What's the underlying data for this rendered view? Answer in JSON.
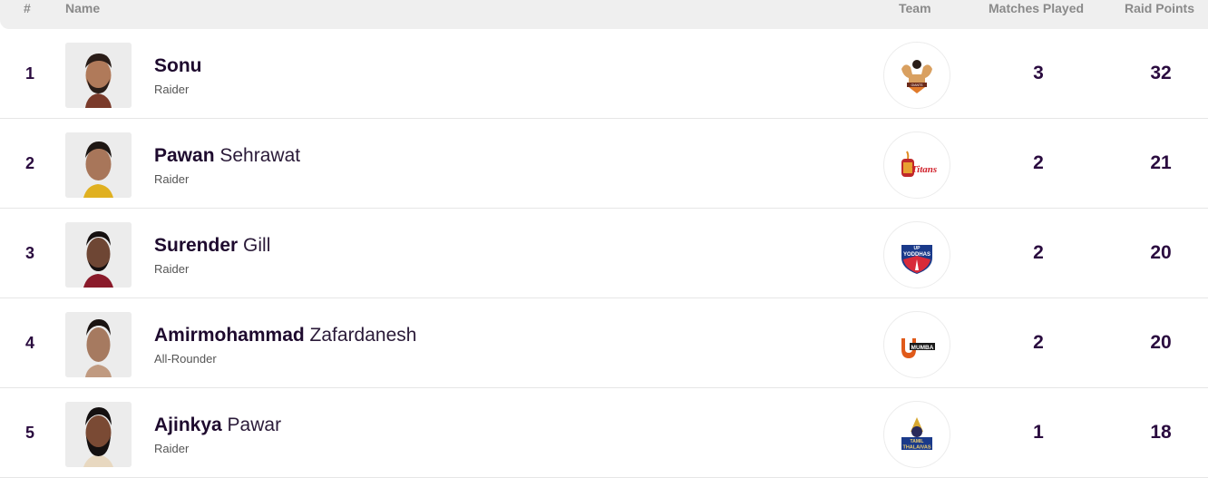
{
  "header": {
    "rank": "#",
    "name": "Name",
    "team": "Team",
    "matches": "Matches Played",
    "raid": "Raid Points"
  },
  "rows": [
    {
      "rank": "1",
      "first": "Sonu",
      "last": "",
      "role": "Raider",
      "team": "Gujarat Giants",
      "team_icon": "gujarat-giants-logo-icon",
      "matches": "3",
      "raid": "32"
    },
    {
      "rank": "2",
      "first": "Pawan",
      "last": "Sehrawat",
      "role": "Raider",
      "team": "Telugu Titans",
      "team_icon": "telugu-titans-logo-icon",
      "matches": "2",
      "raid": "21"
    },
    {
      "rank": "3",
      "first": "Surender",
      "last": "Gill",
      "role": "Raider",
      "team": "UP Yoddhas",
      "team_icon": "up-yoddhas-logo-icon",
      "matches": "2",
      "raid": "20"
    },
    {
      "rank": "4",
      "first": "Amirmohammad",
      "last": "Zafardanesh",
      "role": "All-Rounder",
      "team": "U Mumba",
      "team_icon": "u-mumba-logo-icon",
      "matches": "2",
      "raid": "20"
    },
    {
      "rank": "5",
      "first": "Ajinkya",
      "last": "Pawar",
      "role": "Raider",
      "team": "Tamil Thalaivas",
      "team_icon": "tamil-thalaivas-logo-icon",
      "matches": "1",
      "raid": "18"
    }
  ],
  "team_labels": {
    "gujarat": "GIANTS",
    "titans": "Titans",
    "up": "UP",
    "yoddhas": "YODDHAS",
    "mumba": "MUMBA",
    "tamil": "TAMIL",
    "thalaivas": "THALAIVAS"
  }
}
